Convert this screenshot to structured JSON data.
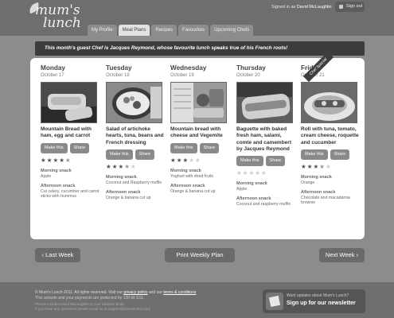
{
  "header": {
    "logo_line1": "mum's",
    "logo_line2": "lunch",
    "signed_in_prefix": "Signed in as",
    "user_name": "David McLaughlin",
    "sign_out": "Sign out"
  },
  "tabs": [
    {
      "label": "My Profile",
      "active": false
    },
    {
      "label": "Meal Plans",
      "active": true
    },
    {
      "label": "Recipes",
      "active": false
    },
    {
      "label": "Favourites",
      "active": false
    },
    {
      "label": "Upcoming Chefs",
      "active": false
    }
  ],
  "banner": "This month's guest Chef is Jacques Reymond, whose favourite lunch speaks true of his French roots!",
  "ribbon": "Chef Special",
  "labels": {
    "make_this": "Make this",
    "share": "Share",
    "morning_snack": "Morning snack",
    "afternoon_snack": "Afternoon snack"
  },
  "days": [
    {
      "name": "Monday",
      "date": "October 17",
      "meal": "Mountain Bread with ham, egg and carrot",
      "rating": 4.5,
      "morning": "Apple",
      "afternoon": "Cut celery, cucumber and carrot sticks with hummus"
    },
    {
      "name": "Tuesday",
      "date": "October 18",
      "meal": "Salad of artichoke hearts, tuna, beans and French dressing",
      "rating": 3.5,
      "morning": "Coconut and Raspberry muffin",
      "afternoon": "Orange & banana cut up"
    },
    {
      "name": "Wednesday",
      "date": "October 19",
      "meal": "Mountain bread with cheese and Vegemite",
      "rating": 3,
      "morning": "Yoghurt with dried fruits",
      "afternoon": "Orange & banana cut up"
    },
    {
      "name": "Thursday",
      "date": "October 20",
      "meal": "Baguette with baked fresh ham, salami, comte and camembert by Jacques Reymond",
      "rating": 0,
      "morning": "Apple",
      "afternoon": "Coconut and raspberry muffin"
    },
    {
      "name": "Friday",
      "date": "October 21",
      "meal": "Roll with tuna, tomato, cream cheese, roquette and cucumber",
      "rating": 3.5,
      "morning": "Orange",
      "afternoon": "Chocolate and macadamia brownie"
    }
  ],
  "nav": {
    "prev": "Last Week",
    "print": "Print Weekly Plan",
    "next": "Next Week"
  },
  "footer": {
    "copyright": "© Mum's Lunch 2011. All rights reserved. Visit our",
    "privacy": "privacy policy",
    "and": "and our",
    "terms": "terms & conditions",
    "line2": "This website and your payments are protected by 128 bit SSL.",
    "line3": "Please include David McLaughlin in your address book.",
    "line4": "If you have any questions please email us at support@mumslunch.com",
    "newsletter_question": "Want updates about Mum's Lunch?",
    "newsletter_cta": "Sign up for our newsletter"
  }
}
